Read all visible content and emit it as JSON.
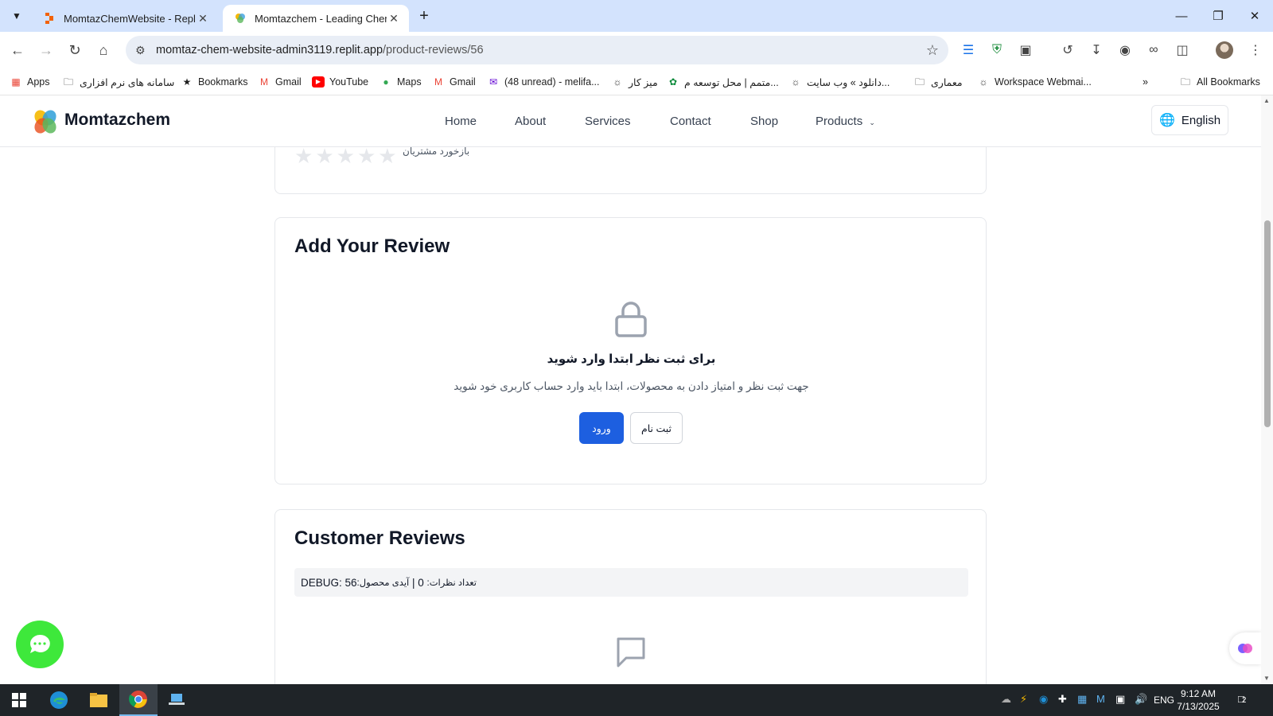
{
  "browser": {
    "tabs": [
      {
        "title": "MomtazChemWebsite - Replit",
        "active": false
      },
      {
        "title": "Momtazchem - Leading Chemic",
        "active": true
      }
    ],
    "url_domain": "momtaz-chem-website-admin3119.replit.app",
    "url_path": "/product-reviews/56",
    "bookmarks": [
      {
        "label": "Apps",
        "icon": "apps-grid-icon"
      },
      {
        "label": "سامانه های نرم افزاری",
        "icon": "folder-icon"
      },
      {
        "label": "Bookmarks",
        "icon": "star-icon"
      },
      {
        "label": "Gmail",
        "icon": "gmail-icon"
      },
      {
        "label": "YouTube",
        "icon": "youtube-icon"
      },
      {
        "label": "Maps",
        "icon": "maps-icon"
      },
      {
        "label": "Gmail",
        "icon": "gmail-icon"
      },
      {
        "label": "(48 unread) - melifa...",
        "icon": "mail-icon"
      },
      {
        "label": "میز کار",
        "icon": "globe-icon"
      },
      {
        "label": "متمم | محل توسعه م...",
        "icon": "leaf-icon"
      },
      {
        "label": "دانلود » وب سایت...",
        "icon": "globe-icon"
      },
      {
        "label": "معماری",
        "icon": "folder-icon"
      },
      {
        "label": "Workspace Webmai...",
        "icon": "globe-icon"
      }
    ],
    "all_bookmarks_label": "All Bookmarks"
  },
  "site": {
    "brand": "Momtazchem",
    "nav": [
      "Home",
      "About",
      "Services",
      "Contact",
      "Shop",
      "Products"
    ],
    "language": "English"
  },
  "rating_card": {
    "label": "بازخورد مشتریان",
    "stars_filled": 0,
    "stars_total": 5
  },
  "add_review": {
    "title": "Add Your Review",
    "login_title": "برای ثبت نظر ابتدا وارد شوید",
    "login_desc": "جهت ثبت نظر و امتیاز دادن به محصولات، ابتدا باید وارد حساب کاربری خود شوید",
    "login_button": "ورود",
    "register_button": "ثبت نام"
  },
  "customer_reviews": {
    "title": "Customer Reviews",
    "debug_prefix": "DEBUG: 56 ",
    "debug_product_label": ":آیدی محصول",
    "debug_sep": " | ",
    "debug_count_value": "0 ",
    "debug_count_label": ":تعداد نظرات"
  },
  "taskbar": {
    "lang": "ENG",
    "time": "9:12 AM",
    "date": "7/13/2025",
    "notifications": "2"
  },
  "colors": {
    "primary": "#1d5fe0",
    "chat_green": "#3ee83b",
    "tabstrip": "#d3e3fd"
  }
}
